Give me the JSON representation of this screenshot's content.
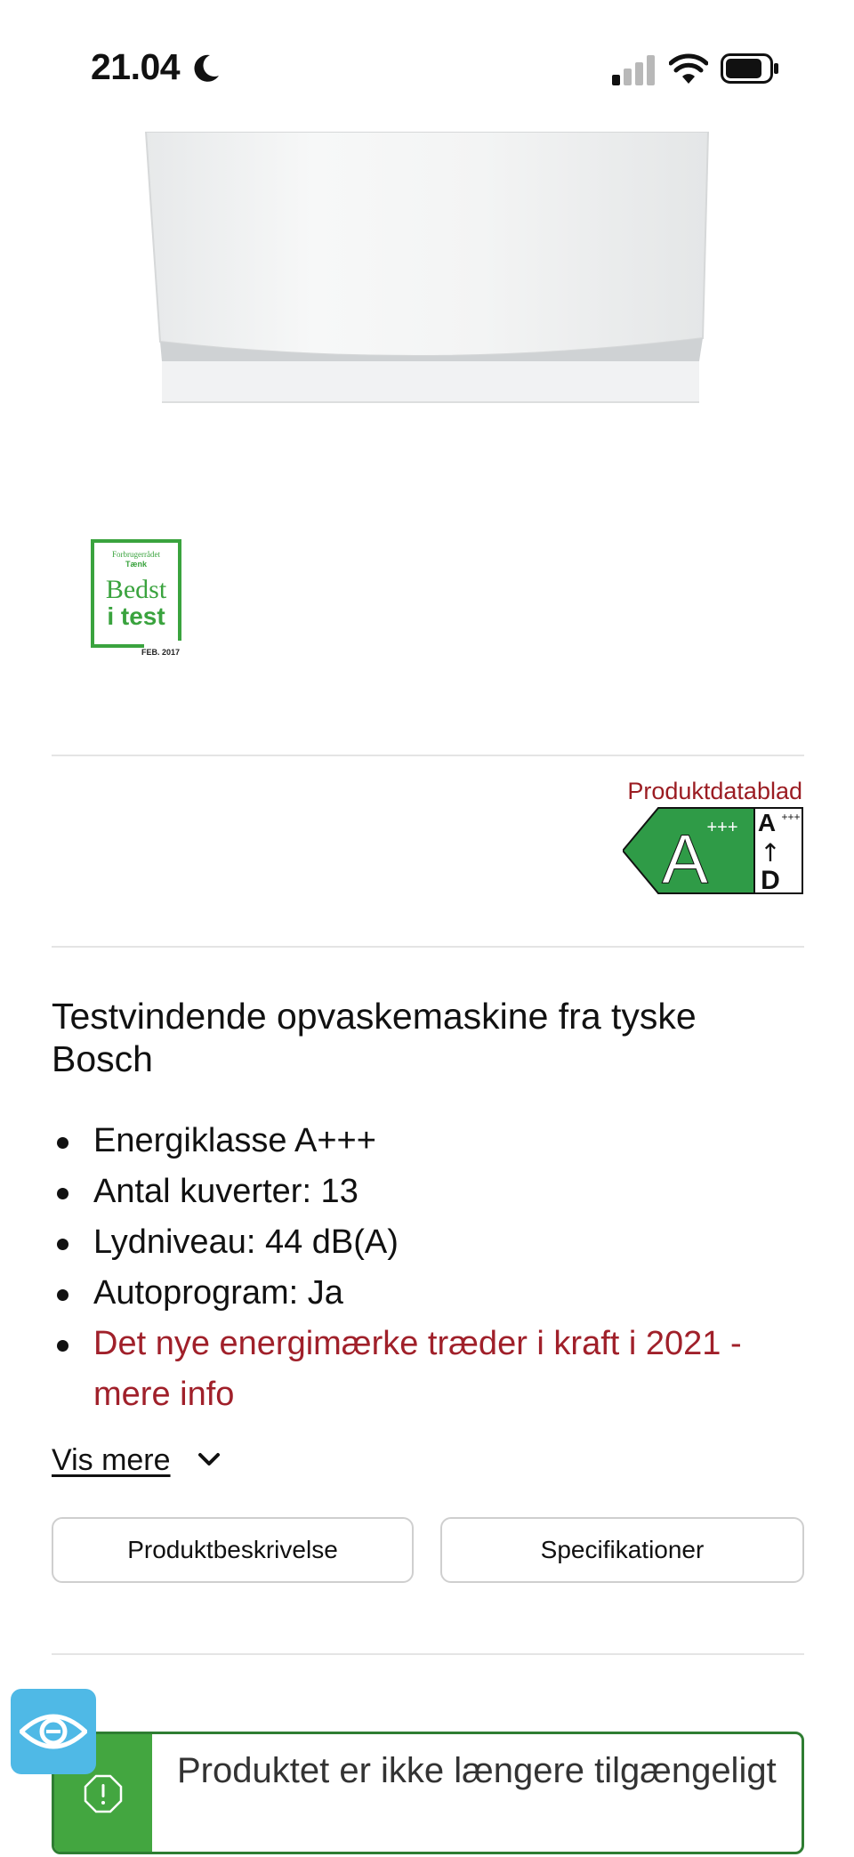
{
  "status_bar": {
    "time": "21.04"
  },
  "badge": {
    "org": "Forbrugerrådet",
    "brand": "Tænk",
    "line1": "Bedst",
    "line2": "i test",
    "date": "FEB. 2017",
    "color": "#3aa33e"
  },
  "energy": {
    "datasheet_label": "Produktdatablad",
    "class_letter": "A",
    "class_plus": "+++",
    "scale_top": "A",
    "scale_top_plus": "+++",
    "scale_arrow": "↑",
    "scale_bottom": "D",
    "color": "#2f9b47"
  },
  "product": {
    "headline": "Testvindende opvaskemaskine fra tyske Bosch",
    "features": [
      "Energiklasse A+++",
      "Antal kuverter: 13",
      "Lydniveau: 44 dB(A)",
      "Autoprogram: Ja"
    ],
    "energy_info_link": "Det nye energimærke træder i kraft i 2021 - mere info",
    "show_more": "Vis mere"
  },
  "tabs": {
    "description": "Produktbeskrivelse",
    "specifications": "Specifikationer"
  },
  "notice": {
    "text": "Produktet er ikke længere tilgængeligt",
    "icon": "alert-octagon-icon"
  },
  "accessibility": {
    "icon": "eye-icon",
    "color": "#4fb9e6"
  },
  "colors": {
    "accent_red": "#9b1c22",
    "notice_green": "#43a640"
  }
}
